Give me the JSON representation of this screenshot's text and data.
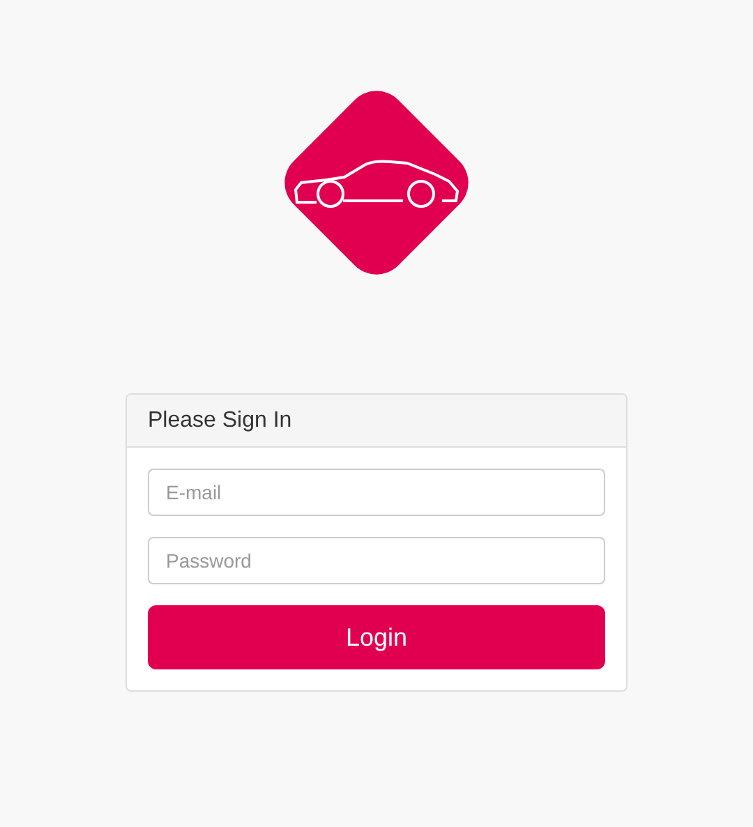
{
  "panel": {
    "heading": "Please Sign In"
  },
  "fields": [
    {
      "placeholder": "E-mail"
    },
    {
      "placeholder": "Password"
    }
  ],
  "button": {
    "label": "Login"
  }
}
